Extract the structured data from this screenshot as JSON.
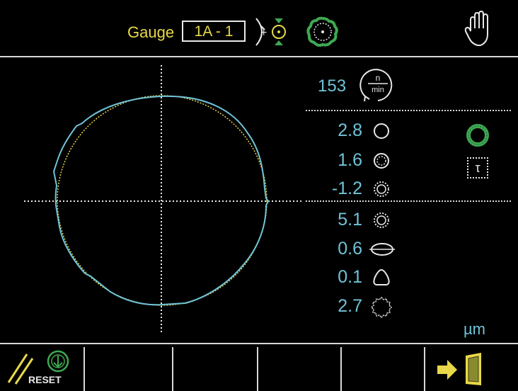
{
  "header": {
    "gauge_label": "Gauge",
    "gauge_id": "1A - 1",
    "icons": [
      "measure-mode-icon",
      "roundness-profile-icon",
      "manual-mode-hand-icon"
    ]
  },
  "speed": {
    "value": "153",
    "unit_top": "n",
    "unit_bottom": "min"
  },
  "measurements": [
    {
      "value": "2.8",
      "icon": "roundness-circle-icon"
    },
    {
      "value": "1.6",
      "icon": "filtered-circle-icon"
    },
    {
      "value": "-1.2",
      "icon": "dotted-circle-icon"
    },
    {
      "value": "5.1",
      "icon": "dotted-circle-alt-icon"
    },
    {
      "value": "0.6",
      "icon": "ovality-icon"
    },
    {
      "value": "0.1",
      "icon": "triangle-lobing-icon"
    },
    {
      "value": "2.7",
      "icon": "waviness-icon"
    }
  ],
  "side_icons": [
    "profile-ring-icon",
    "tau-filter-icon"
  ],
  "tau_label": "τ",
  "unit_label": "µm",
  "footer": {
    "reset_label": "RESET",
    "icons": [
      "reset-slash-icon",
      "start-icon",
      "exit-door-icon"
    ]
  },
  "colors": {
    "accent": "#e8d84a",
    "value": "#6fc3d6",
    "profile_green": "#3fa852",
    "line": "#d8d8d8"
  }
}
